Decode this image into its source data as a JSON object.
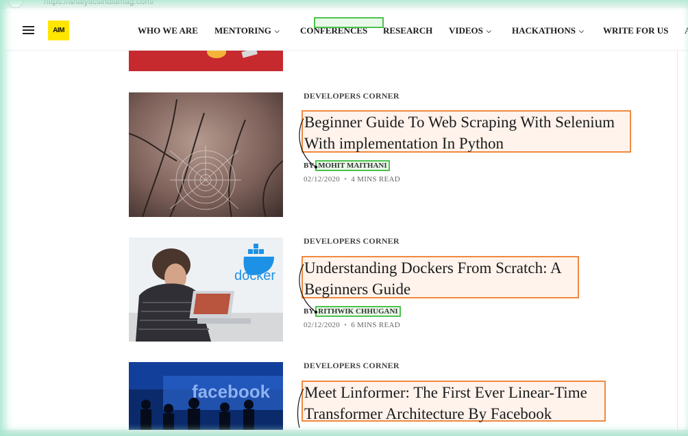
{
  "browser": {
    "url_text": "https://analyticsindiamag.com/"
  },
  "header": {
    "logo_text": "AIM",
    "nav": [
      {
        "label": "WHO WE ARE",
        "dropdown": false
      },
      {
        "label": "MENTORING",
        "dropdown": true
      },
      {
        "label": "CONFERENCES",
        "dropdown": false
      },
      {
        "label": "RESEARCH",
        "dropdown": false
      },
      {
        "label": "VIDEOS",
        "dropdown": true
      },
      {
        "label": "HACKATHONS",
        "dropdown": true
      },
      {
        "label": "WRITE FOR US",
        "dropdown": false
      },
      {
        "label": "A",
        "dropdown": false
      }
    ]
  },
  "articles": [
    {
      "category": "DEVELOPERS CORNER",
      "title": "Beginner Guide To Web Scraping With Selenium With implementation In Python",
      "by": "BY",
      "author": "MOHIT MAITHANI",
      "date": "02/12/2020",
      "read_time": "4 MINS READ",
      "image": "spider-web-photo"
    },
    {
      "category": "DEVELOPERS CORNER",
      "title": "Understanding Dockers From Scratch: A Beginners Guide",
      "by": "BY",
      "author": "RITHWIK CHHUGANI",
      "date": "02/12/2020",
      "read_time": "6 MINS READ",
      "image": "docker-developer-photo",
      "image_text": "docker"
    },
    {
      "category": "DEVELOPERS CORNER",
      "title": "Meet Linformer: The First Ever Linear-Time Transformer Architecture By Facebook",
      "image": "facebook-event-photo",
      "image_text": "facebook"
    }
  ],
  "colors": {
    "logo_bg": "#ffe600",
    "title_highlight_border": "#f0883e",
    "author_highlight_border": "#4cc24c",
    "frame_glow": "#a8e6cf"
  }
}
